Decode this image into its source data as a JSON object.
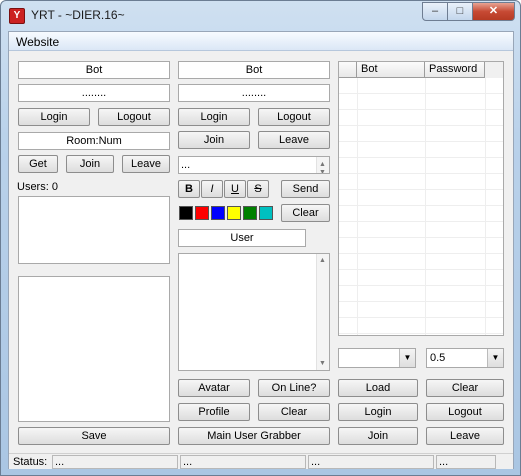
{
  "window": {
    "title": "YRT - ~DIER.16~",
    "icon": "app-icon",
    "minimize": "–",
    "maximize": "□",
    "close": "✕"
  },
  "menu": {
    "items": [
      "Website"
    ]
  },
  "left": {
    "bot_name": "Bot",
    "password": "........",
    "login": "Login",
    "logout": "Logout",
    "room": "Room:Num",
    "get": "Get",
    "join": "Join",
    "leave": "Leave",
    "users_label": "Users: 0",
    "save": "Save"
  },
  "middle": {
    "bot_name": "Bot",
    "password": "........",
    "login": "Login",
    "logout": "Logout",
    "join": "Join",
    "leave": "Leave",
    "message": "...",
    "bold": "B",
    "italic": "I",
    "underline": "U",
    "strike": "S",
    "send": "Send",
    "clear": "Clear",
    "colors": [
      "#000000",
      "#ff0000",
      "#0000ff",
      "#ffff00",
      "#008000",
      "#00c0c0"
    ],
    "user_field": "User",
    "avatar": "Avatar",
    "online": "On Line?",
    "profile": "Profile",
    "clear2": "Clear",
    "grabber": "Main User Grabber"
  },
  "right": {
    "columns": [
      "Bot",
      "Password"
    ],
    "combo1": "",
    "combo2": "0.5",
    "load": "Load",
    "clear": "Clear",
    "login": "Login",
    "logout": "Logout",
    "join": "Join",
    "leave": "Leave"
  },
  "status": {
    "label": "Status:",
    "panels": [
      "...",
      "...",
      "...",
      "..."
    ]
  }
}
